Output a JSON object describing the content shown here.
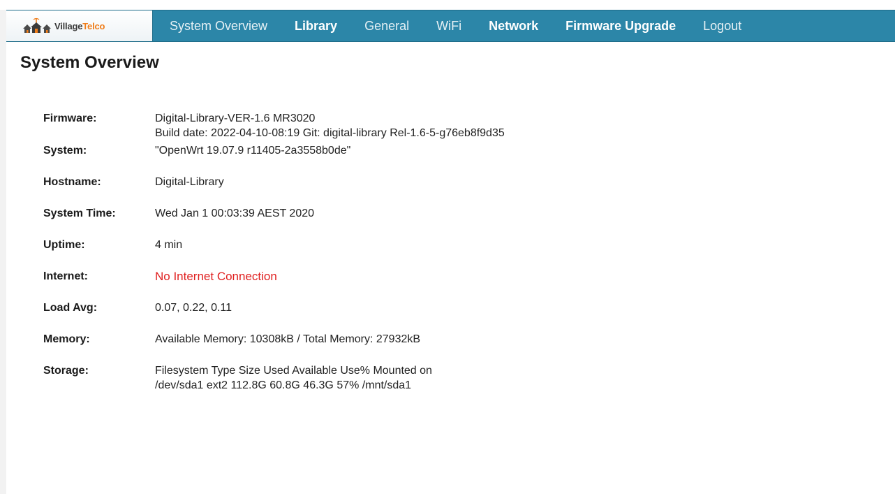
{
  "brand": {
    "name_part1": "Village",
    "name_part2": "Telco",
    "icon": "village-houses-logo"
  },
  "nav": {
    "items": [
      {
        "label": "System Overview",
        "bold": false
      },
      {
        "label": "Library",
        "bold": true
      },
      {
        "label": "General",
        "bold": false
      },
      {
        "label": "WiFi",
        "bold": false
      },
      {
        "label": "Network",
        "bold": true
      },
      {
        "label": "Firmware Upgrade",
        "bold": true
      },
      {
        "label": "Logout",
        "bold": false
      }
    ]
  },
  "page": {
    "title": "System Overview"
  },
  "info": {
    "firmware": {
      "label": "Firmware:",
      "line1": "Digital-Library-VER-1.6 MR3020",
      "line2": "Build date: 2022-04-10-08:19 Git: digital-library Rel-1.6-5-g76eb8f9d35"
    },
    "system": {
      "label": "System:",
      "value": "\"OpenWrt 19.07.9 r11405-2a3558b0de\""
    },
    "hostname": {
      "label": "Hostname:",
      "value": "Digital-Library"
    },
    "system_time": {
      "label": "System Time:",
      "value": "Wed Jan 1 00:03:39 AEST 2020"
    },
    "uptime": {
      "label": "Uptime:",
      "value": "4 min"
    },
    "internet": {
      "label": "Internet:",
      "value": "No Internet Connection",
      "color": "#e02020"
    },
    "load_avg": {
      "label": "Load Avg:",
      "value": "0.07, 0.22, 0.11"
    },
    "memory": {
      "label": "Memory:",
      "value": "Available Memory: 10308kB / Total Memory: 27932kB"
    },
    "storage": {
      "label": "Storage:",
      "line1": "Filesystem Type Size Used Available Use% Mounted on",
      "line2": "/dev/sda1 ext2 112.8G 60.8G 46.3G 57% /mnt/sda1"
    }
  },
  "colors": {
    "navbar": "#2c86a8",
    "brand_accent": "#f07d1a",
    "alert": "#e02020"
  }
}
